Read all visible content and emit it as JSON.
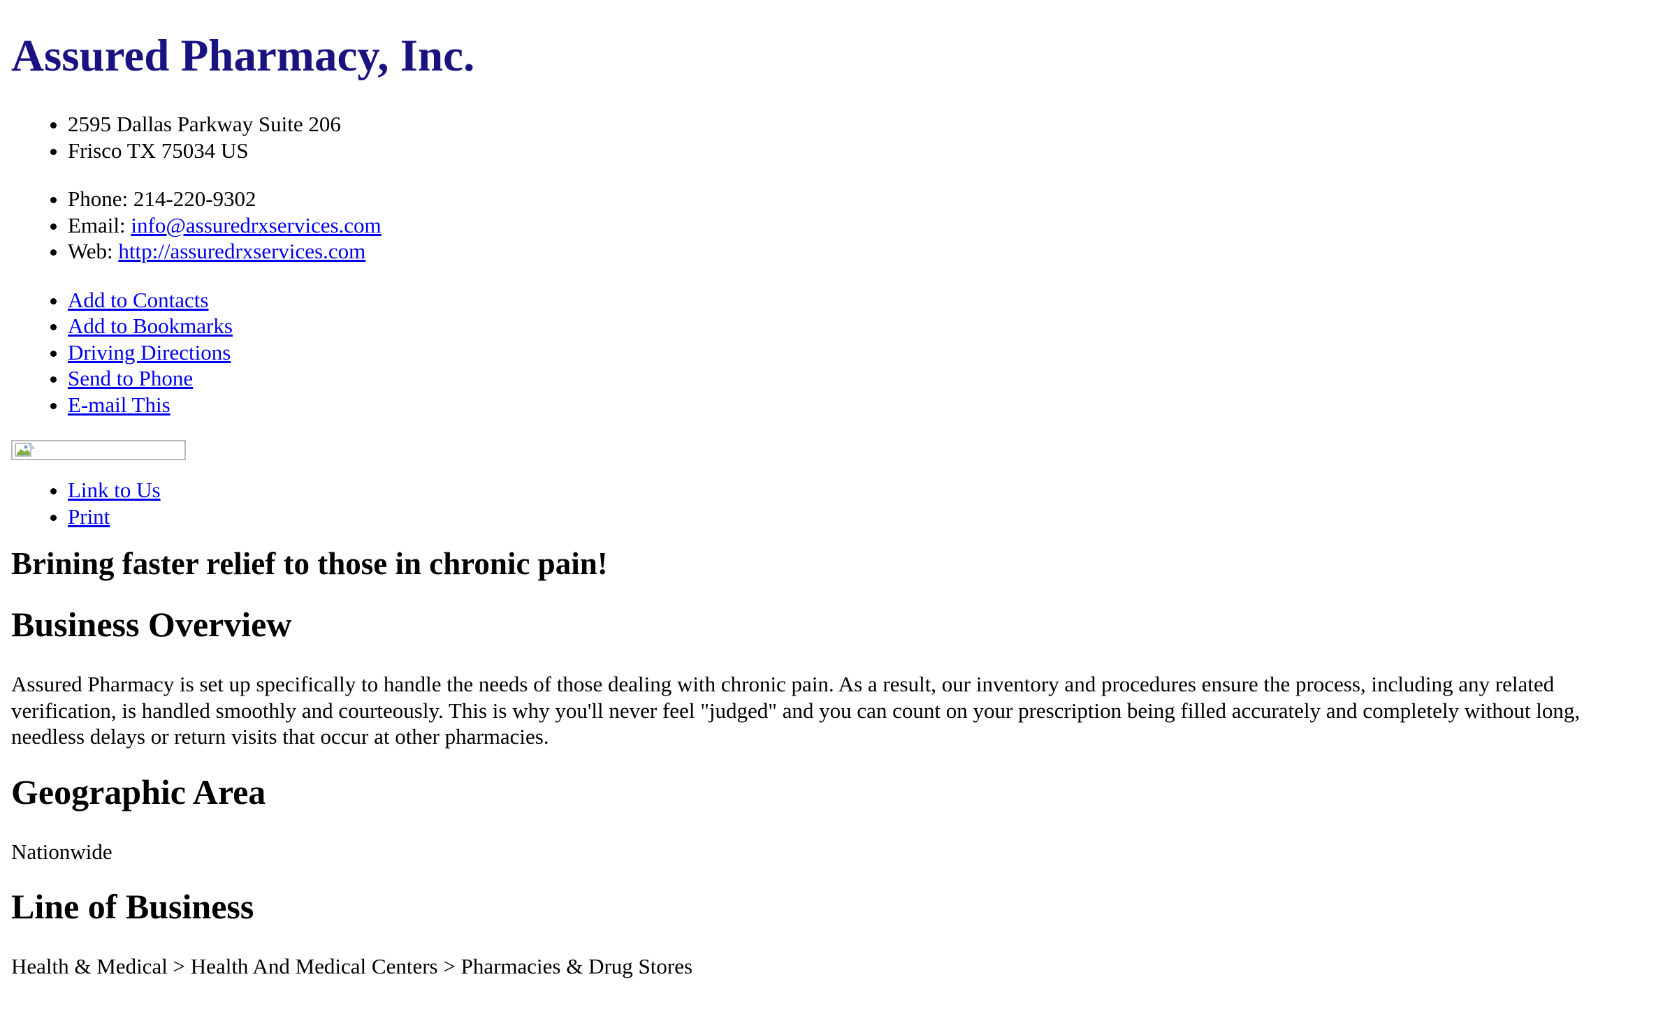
{
  "company": {
    "name": "Assured Pharmacy, Inc."
  },
  "address": {
    "line1": "2595 Dallas Parkway Suite 206",
    "line2": "Frisco TX 75034 US"
  },
  "contact": {
    "phone_label": "Phone: ",
    "phone": "214-220-9302",
    "email_label": "Email: ",
    "email": "info@assuredrxservices.com",
    "web_label": "Web: ",
    "web": "http://assuredrxservices.com"
  },
  "actions": {
    "add_to_contacts": "Add to Contacts",
    "add_to_bookmarks": "Add to Bookmarks",
    "driving_directions": "Driving Directions",
    "send_to_phone": "Send to Phone",
    "email_this": "E-mail This"
  },
  "extra_links": {
    "link_to_us": "Link to Us",
    "print": "Print"
  },
  "tagline": "Brining faster relief to those in chronic pain!",
  "overview": {
    "heading": "Business Overview",
    "text": "Assured Pharmacy is set up specifically to handle the needs of those dealing with chronic pain. As a result, our inventory and procedures ensure the process, including any related verification, is handled smoothly and courteously. This is why you'll never feel \"judged\" and you can count on your prescription being filled accurately and completely without long, needless delays or return visits that occur at other pharmacies."
  },
  "geographic": {
    "heading": "Geographic Area",
    "text": "Nationwide"
  },
  "line_of_business": {
    "heading": "Line of Business",
    "text": "Health & Medical > Health And Medical Centers > Pharmacies & Drug Stores"
  },
  "colors": {
    "title": "#1a1280",
    "link": "#0000ee",
    "text": "#000000",
    "background": "#ffffff"
  },
  "icons": {
    "badge_image": "broken-image-icon"
  }
}
